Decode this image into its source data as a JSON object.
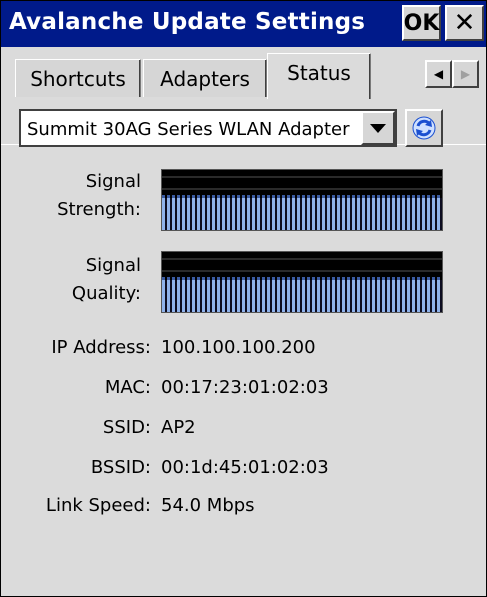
{
  "window": {
    "title": "Avalanche Update Settings",
    "ok_label": "OK",
    "close_label": "✕"
  },
  "tabs": [
    {
      "label": "Shortcuts",
      "active": false
    },
    {
      "label": "Adapters",
      "active": false
    },
    {
      "label": "Status",
      "active": true
    }
  ],
  "tab_scroll": {
    "left_glyph": "◀",
    "right_glyph": "▶"
  },
  "adapter_select": {
    "value": "Summit 30AG Series WLAN Adapter"
  },
  "refresh": {
    "icon": "refresh-icon"
  },
  "signal": {
    "strength_label_1": "Signal",
    "strength_label_2": "Strength:",
    "quality_label_1": "Signal",
    "quality_label_2": "Quality:"
  },
  "info": [
    {
      "label": "IP Address:",
      "value": "100.100.100.200"
    },
    {
      "label": "MAC:",
      "value": "00:17:23:01:02:03"
    },
    {
      "label": "SSID:",
      "value": "AP2"
    },
    {
      "label": "BSSID:",
      "value": "00:1d:45:01:02:03"
    },
    {
      "label": "Link Speed:",
      "value": "54.0 Mbps"
    }
  ],
  "colors": {
    "titlebar": "#001a8a",
    "signal_fill": "#8fb2ea"
  }
}
